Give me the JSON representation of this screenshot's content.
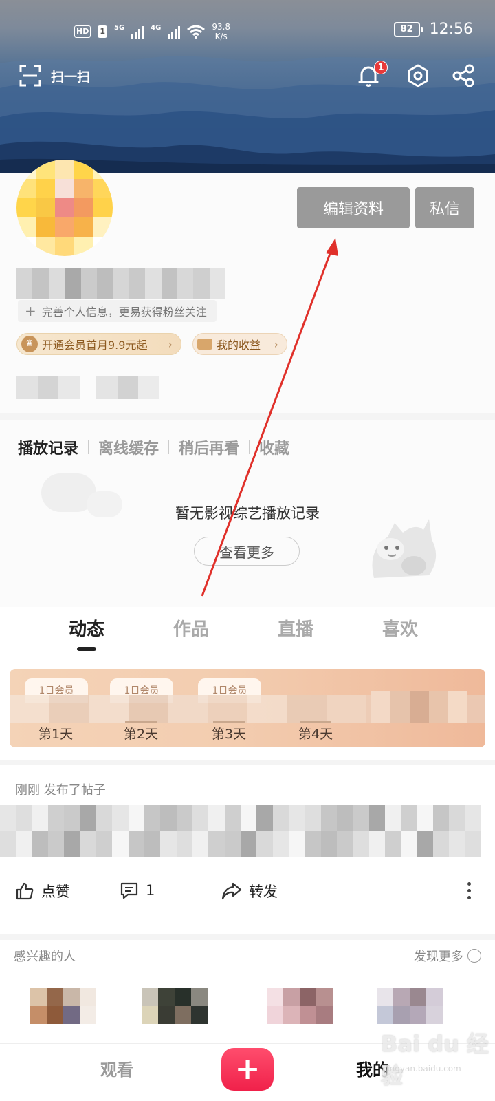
{
  "status_bar": {
    "hd": "HD",
    "sim": "1",
    "net1": "5G",
    "net2": "4G",
    "speed_value": "93.8",
    "speed_unit": "K/s",
    "battery": "82",
    "time": "12:56"
  },
  "header": {
    "scan_label": "扫一扫",
    "notification_count": "1"
  },
  "profile": {
    "edit_button": "编辑资料",
    "message_button": "私信",
    "complete_info_hint": "完善个人信息，更易获得粉丝关注",
    "vip_promo": "开通会员首月9.9元起",
    "earnings": "我的收益"
  },
  "history": {
    "tabs": [
      "播放记录",
      "离线缓存",
      "稍后再看",
      "收藏"
    ],
    "empty_text": "暂无影视综艺播放记录",
    "more_button": "查看更多"
  },
  "content_tabs": [
    "动态",
    "作品",
    "直播",
    "喜欢"
  ],
  "checkin": {
    "days": [
      "第1天",
      "第2天",
      "第3天",
      "第4天"
    ],
    "slot_labels": [
      "1日会员",
      "1日会员",
      "1日会员"
    ]
  },
  "post": {
    "meta": "刚刚 发布了帖子",
    "like_label": "点赞",
    "comment_count": "1",
    "share_label": "转发"
  },
  "interest": {
    "title": "感兴趣的人",
    "more": "发现更多"
  },
  "bottom_nav": {
    "watch": "观看",
    "plus": "+",
    "mine": "我的"
  },
  "watermark": {
    "logo": "Bai du 经验",
    "sub": "jingyan.baidu.com"
  },
  "colors": {
    "accent_red": "#f0214a",
    "badge_red": "#e83a3a",
    "button_gray": "#9a9a9a",
    "annotation_red": "#e0302a"
  }
}
